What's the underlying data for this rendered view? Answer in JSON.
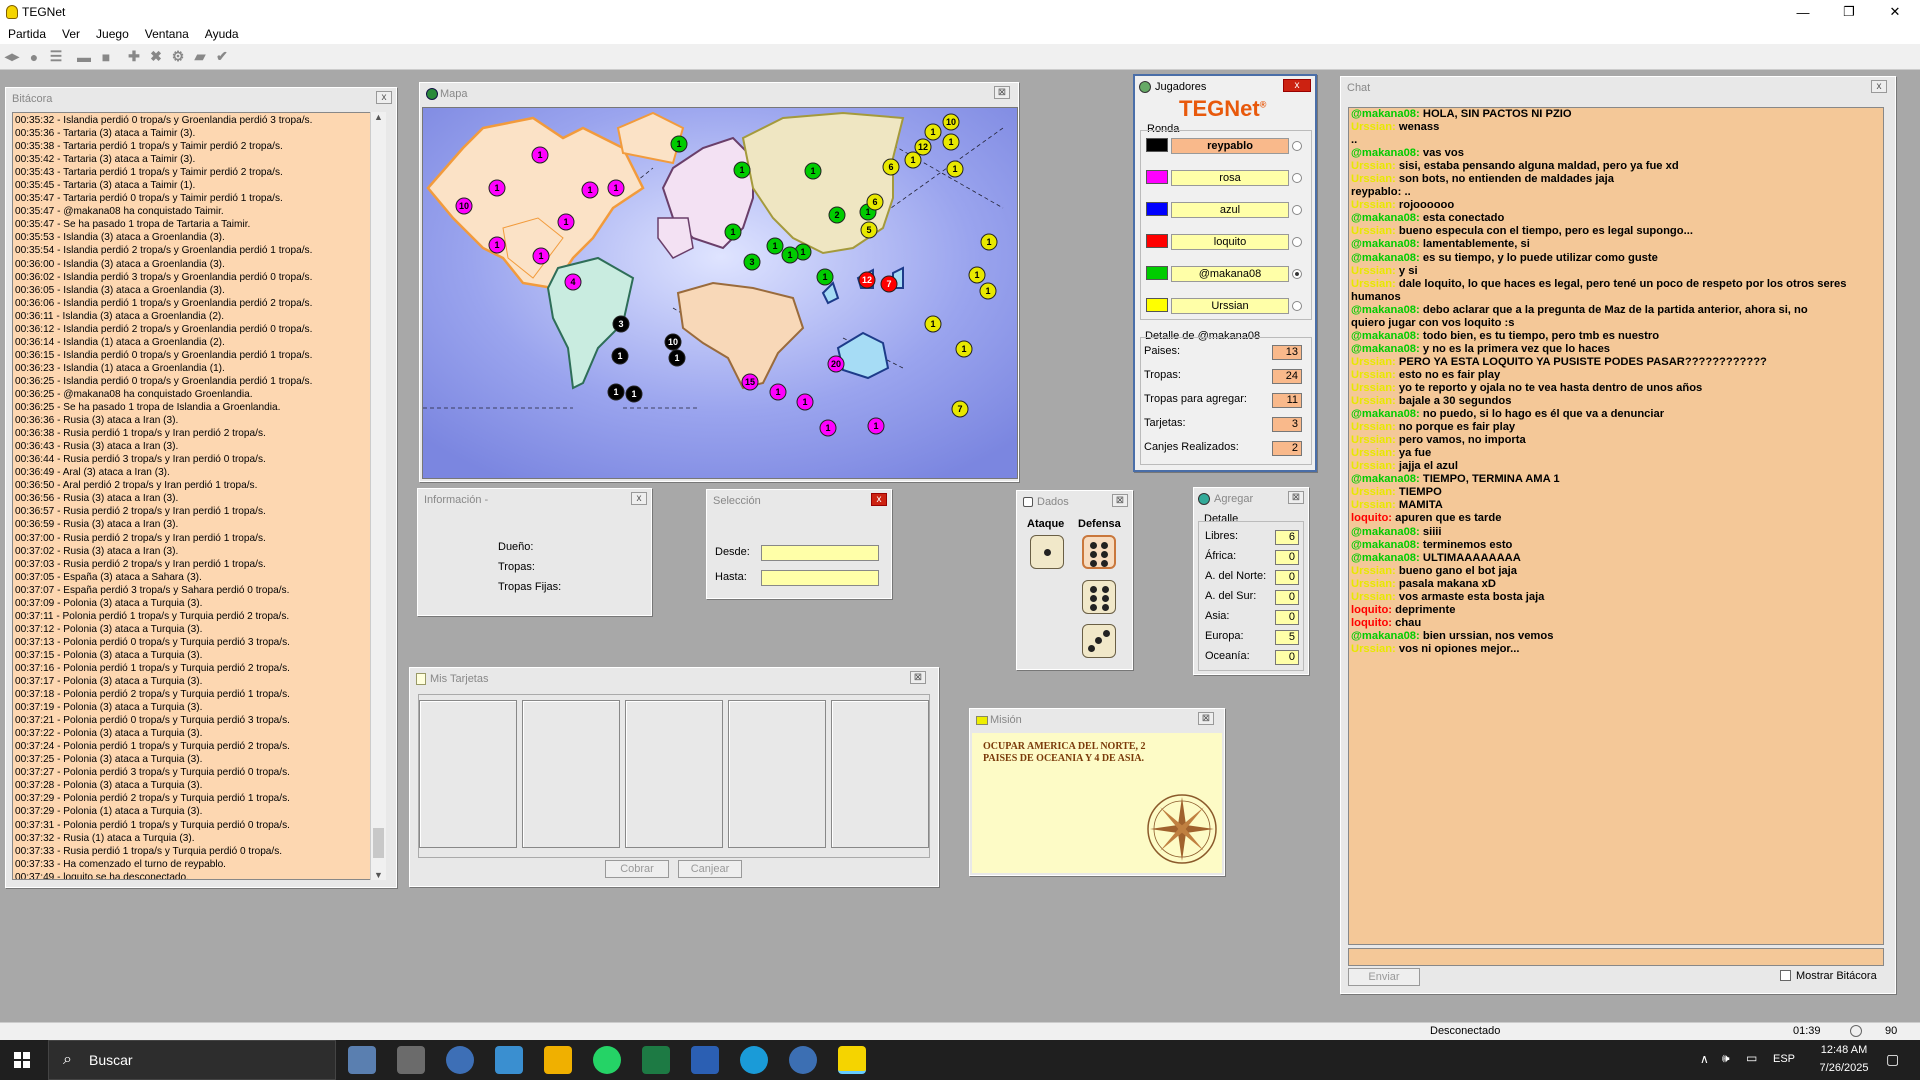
{
  "window": {
    "title": "TEGNet",
    "min": "—",
    "max": "❐",
    "close": "✕"
  },
  "menu": [
    "Partida",
    "Ver",
    "Juego",
    "Ventana",
    "Ayuda"
  ],
  "toolbar_icons": [
    "connect-icon",
    "start-icon",
    "list-icon",
    "stop-icon",
    "square-icon",
    "add-icon",
    "close-icon",
    "gear-icon",
    "card-icon",
    "check-icon"
  ],
  "bitacora": {
    "title": "Bitácora",
    "close": "x",
    "lines": [
      "00:35:32 - Islandia perdió 0 tropa/s y Groenlandia perdió 3 tropa/s.",
      "00:35:36 - Tartaria (3) ataca a Taimir (3).",
      "00:35:38 - Tartaria perdió 1 tropa/s y Taimir perdió 2 tropa/s.",
      "00:35:42 - Tartaria (3) ataca a Taimir (3).",
      "00:35:43 - Tartaria perdió 1 tropa/s y Taimir perdió 2 tropa/s.",
      "00:35:45 - Tartaria (3) ataca a Taimir (1).",
      "00:35:47 - Tartaria perdió 0 tropa/s y Taimir perdió 1 tropa/s.",
      "00:35:47 - @makana08 ha conquistado Taimir.",
      "00:35:47 - Se ha pasado 1 tropa de Tartaria a Taimir.",
      "00:35:53 - Islandia (3) ataca a Groenlandia (3).",
      "00:35:54 - Islandia perdió 2 tropa/s y Groenlandia perdió 1 tropa/s.",
      "00:36:00 - Islandia (3) ataca a Groenlandia (3).",
      "00:36:02 - Islandia perdió 3 tropa/s y Groenlandia perdió 0 tropa/s.",
      "00:36:05 - Islandia (3) ataca a Groenlandia (3).",
      "00:36:06 - Islandia perdió 1 tropa/s y Groenlandia perdió 2 tropa/s.",
      "00:36:11 - Islandia (3) ataca a Groenlandia (2).",
      "00:36:12 - Islandia perdió 2 tropa/s y Groenlandia perdió 0 tropa/s.",
      "00:36:14 - Islandia (1) ataca a Groenlandia (2).",
      "00:36:15 - Islandia perdió 0 tropa/s y Groenlandia perdió 1 tropa/s.",
      "00:36:23 - Islandia (1) ataca a Groenlandia (1).",
      "00:36:25 - Islandia perdió 0 tropa/s y Groenlandia perdió 1 tropa/s.",
      "00:36:25 - @makana08 ha conquistado Groenlandia.",
      "00:36:25 - Se ha pasado 1 tropa de Islandia a Groenlandia.",
      "00:36:36 - Rusia (3) ataca a Iran (3).",
      "00:36:38 - Rusia perdió 1 tropa/s y Iran perdió 2 tropa/s.",
      "00:36:43 - Rusia (3) ataca a Iran (3).",
      "00:36:44 - Rusia perdió 3 tropa/s y Iran perdió 0 tropa/s.",
      "00:36:49 - Aral (3) ataca a Iran (3).",
      "00:36:50 - Aral perdió 2 tropa/s y Iran perdió 1 tropa/s.",
      "00:36:56 - Rusia (3) ataca a Iran (3).",
      "00:36:57 - Rusia perdió 2 tropa/s y Iran perdió 1 tropa/s.",
      "00:36:59 - Rusia (3) ataca a Iran (3).",
      "00:37:00 - Rusia perdió 2 tropa/s y Iran perdió 1 tropa/s.",
      "00:37:02 - Rusia (3) ataca a Iran (3).",
      "00:37:03 - Rusia perdió 2 tropa/s y Iran perdió 1 tropa/s.",
      "00:37:05 - España (3) ataca a Sahara (3).",
      "00:37:07 - España perdió 3 tropa/s y Sahara perdió 0 tropa/s.",
      "00:37:09 - Polonia (3) ataca a Turquia (3).",
      "00:37:11 - Polonia perdió 1 tropa/s y Turquia perdió 2 tropa/s.",
      "00:37:12 - Polonia (3) ataca a Turquia (3).",
      "00:37:13 - Polonia perdió 0 tropa/s y Turquia perdió 3 tropa/s.",
      "00:37:15 - Polonia (3) ataca a Turquia (3).",
      "00:37:16 - Polonia perdió 1 tropa/s y Turquia perdió 2 tropa/s.",
      "00:37:17 - Polonia (3) ataca a Turquia (3).",
      "00:37:18 - Polonia perdió 2 tropa/s y Turquia perdió 1 tropa/s.",
      "00:37:19 - Polonia (3) ataca a Turquia (3).",
      "00:37:21 - Polonia perdió 0 tropa/s y Turquia perdió 3 tropa/s.",
      "00:37:22 - Polonia (3) ataca a Turquia (3).",
      "00:37:24 - Polonia perdió 1 tropa/s y Turquia perdió 2 tropa/s.",
      "00:37:25 - Polonia (3) ataca a Turquia (3).",
      "00:37:27 - Polonia perdió 3 tropa/s y Turquia perdió 0 tropa/s.",
      "00:37:28 - Polonia (3) ataca a Turquia (3).",
      "00:37:29 - Polonia perdió 2 tropa/s y Turquia perdió 1 tropa/s.",
      "00:37:29 - Polonia (1) ataca a Turquia (3).",
      "00:37:31 - Polonia perdió 1 tropa/s y Turquia perdió 0 tropa/s.",
      "00:37:32 - Rusia (1) ataca a Turquia (3).",
      "00:37:33 - Rusia perdió 1 tropa/s y Turquia perdió 0 tropa/s.",
      "00:37:33 - Ha comenzado el turno de reypablo.",
      "00:37:49 - loquito se ha desconectado."
    ]
  },
  "mapa": {
    "title": "Mapa",
    "close": "⊠"
  },
  "informacion": {
    "title": "Información -",
    "close": "x",
    "dueno": "Dueño:",
    "tropas": "Tropas:",
    "tropas_fijas": "Tropas Fijas:"
  },
  "seleccion": {
    "title": "Selección",
    "close": "x",
    "desde": "Desde:",
    "hasta": "Hasta:"
  },
  "tarjetas": {
    "title": "Mis Tarjetas",
    "close": "⊠",
    "cobrar": "Cobrar",
    "canjear": "Canjear"
  },
  "dados": {
    "title": "Dados",
    "close": "⊠",
    "ataque": "Ataque",
    "defensa": "Defensa",
    "ataque_dice": [
      1
    ],
    "defensa_dice": [
      6,
      6,
      3
    ]
  },
  "jugadores": {
    "title": "Jugadores",
    "close": "x",
    "logo": "TEGNet",
    "logo_mark": "®",
    "ronda": "Ronda",
    "players": [
      {
        "color": "#000000",
        "name": "reypablo",
        "active": true
      },
      {
        "color": "#ff00ff",
        "name": "rosa",
        "active": false
      },
      {
        "color": "#0000ff",
        "name": "azul",
        "active": false
      },
      {
        "color": "#ff0000",
        "name": "loquito",
        "active": false
      },
      {
        "color": "#00cc00",
        "name": "@makana08",
        "active": false,
        "selected": true
      },
      {
        "color": "#ffff00",
        "name": "Urssian",
        "active": false
      }
    ],
    "detalle_title": "Detalle de @makana08",
    "stats": [
      {
        "label": "Paises:",
        "value": "13"
      },
      {
        "label": "Tropas:",
        "value": "24"
      },
      {
        "label": "Tropas para agregar:",
        "value": "11"
      },
      {
        "label": "Tarjetas:",
        "value": "3"
      },
      {
        "label": "Canjes Realizados:",
        "value": "2"
      }
    ]
  },
  "agregar": {
    "title": "Agregar",
    "close": "⊠",
    "detalle": "Detalle",
    "rows": [
      {
        "label": "Libres:",
        "value": "6"
      },
      {
        "label": "África:",
        "value": "0"
      },
      {
        "label": "A. del Norte:",
        "value": "0"
      },
      {
        "label": "A. del Sur:",
        "value": "0"
      },
      {
        "label": "Asia:",
        "value": "0"
      },
      {
        "label": "Europa:",
        "value": "5"
      },
      {
        "label": "Oceanía:",
        "value": "0"
      }
    ]
  },
  "mision": {
    "title": "Misión",
    "close": "⊠",
    "text1": "OCUPAR AMERICA DEL NORTE, 2",
    "text2": "PAISES DE OCEANIA Y 4 DE ASIA."
  },
  "chat": {
    "title": "Chat",
    "close": "x",
    "enviar": "Enviar",
    "mostrar": "Mostrar Bitácora",
    "lines": [
      {
        "u": "@makana08:",
        "c": "#00cc00",
        "m": "HOLA, SIN PACTOS NI PZIO"
      },
      {
        "u": "Urssian:",
        "c": "#e8e800",
        "m": "wenass"
      },
      {
        "u": "",
        "c": "#000",
        "m": ".."
      },
      {
        "u": "@makana08:",
        "c": "#00cc00",
        "m": "vas vos"
      },
      {
        "u": "Urssian:",
        "c": "#e8e800",
        "m": "sisi, estaba pensando alguna maldad, pero ya fue xd"
      },
      {
        "u": "Urssian:",
        "c": "#e8e800",
        "m": "son bots, no entienden de maldades jaja"
      },
      {
        "u": "reypablo:",
        "c": "#000",
        "m": ".."
      },
      {
        "u": "Urssian:",
        "c": "#e8e800",
        "m": "rojoooooo"
      },
      {
        "u": "@makana08:",
        "c": "#00cc00",
        "m": "esta conectado"
      },
      {
        "u": "Urssian:",
        "c": "#e8e800",
        "m": "bueno especula con el tiempo, pero es legal supongo..."
      },
      {
        "u": "@makana08:",
        "c": "#00cc00",
        "m": "lamentablemente, si"
      },
      {
        "u": "@makana08:",
        "c": "#00cc00",
        "m": "es su tiempo, y lo puede utilizar como guste"
      },
      {
        "u": "Urssian:",
        "c": "#e8e800",
        "m": "y si"
      },
      {
        "u": "Urssian:",
        "c": "#e8e800",
        "m": "dale loquito, lo que haces es legal, pero tené un poco de respeto por los otros seres"
      },
      {
        "u": "",
        "c": "#000",
        "m": "humanos"
      },
      {
        "u": "@makana08:",
        "c": "#00cc00",
        "m": "debo aclarar que a la pregunta de Maz de la partida anterior, ahora si, no"
      },
      {
        "u": "",
        "c": "#000",
        "m": "quiero jugar con vos loquito :s"
      },
      {
        "u": "@makana08:",
        "c": "#00cc00",
        "m": "todo bien, es tu tiempo, pero tmb es nuestro"
      },
      {
        "u": "@makana08:",
        "c": "#00cc00",
        "m": "y no es la primera vez que lo haces"
      },
      {
        "u": "Urssian:",
        "c": "#e8e800",
        "m": "PERO YA ESTA LOQUITO YA PUSISTE PODES PASAR????????????"
      },
      {
        "u": "Urssian:",
        "c": "#e8e800",
        "m": "esto no es fair play"
      },
      {
        "u": "Urssian:",
        "c": "#e8e800",
        "m": "yo te reporto y ojala no te vea hasta dentro de unos años"
      },
      {
        "u": "Urssian:",
        "c": "#e8e800",
        "m": "bajale a 30 segundos"
      },
      {
        "u": "@makana08:",
        "c": "#00cc00",
        "m": "no puedo, si lo hago es él que va a denunciar"
      },
      {
        "u": "Urssian:",
        "c": "#e8e800",
        "m": "no porque es fair play"
      },
      {
        "u": "Urssian:",
        "c": "#e8e800",
        "m": "pero vamos, no importa"
      },
      {
        "u": "Urssian:",
        "c": "#e8e800",
        "m": "ya fue"
      },
      {
        "u": "Urssian:",
        "c": "#e8e800",
        "m": "jajja el azul"
      },
      {
        "u": "@makana08:",
        "c": "#00cc00",
        "m": "TIEMPO, TERMINA AMA 1"
      },
      {
        "u": "Urssian:",
        "c": "#e8e800",
        "m": "TIEMPO"
      },
      {
        "u": "Urssian:",
        "c": "#e8e800",
        "m": "MAMITA"
      },
      {
        "u": "loquito:",
        "c": "#ff0000",
        "m": "apuren que es tarde"
      },
      {
        "u": "@makana08:",
        "c": "#00cc00",
        "m": "siiii"
      },
      {
        "u": "@makana08:",
        "c": "#00cc00",
        "m": "terminemos esto"
      },
      {
        "u": "@makana08:",
        "c": "#00cc00",
        "m": "ULTIMAAAAAAAA"
      },
      {
        "u": "Urssian:",
        "c": "#e8e800",
        "m": "bueno gano el bot jaja"
      },
      {
        "u": "Urssian:",
        "c": "#e8e800",
        "m": "pasala makana xD"
      },
      {
        "u": "Urssian:",
        "c": "#e8e800",
        "m": "vos armaste esta bosta jaja"
      },
      {
        "u": "loquito:",
        "c": "#ff0000",
        "m": "deprimente"
      },
      {
        "u": "loquito:",
        "c": "#ff0000",
        "m": "chau"
      },
      {
        "u": "@makana08:",
        "c": "#00cc00",
        "m": "bien urssian, nos vemos"
      },
      {
        "u": "Urssian:",
        "c": "#e8e800",
        "m": "vos ni opiones mejor..."
      }
    ]
  },
  "status": {
    "state": "Desconectado",
    "time": "01:39",
    "num": "90"
  },
  "taskbar": {
    "search": "Buscar",
    "lang": "ESP",
    "time": "12:48 AM",
    "date": "7/26/2025"
  },
  "map_armies": [
    {
      "n": "1",
      "c": "#ff00ff"
    },
    {
      "n": "1",
      "c": "#ff00ff"
    },
    {
      "n": "10",
      "c": "#ff00ff"
    },
    {
      "n": "1",
      "c": "#ff00ff"
    },
    {
      "n": "1",
      "c": "#ff00ff"
    },
    {
      "n": "1",
      "c": "#ff00ff"
    },
    {
      "n": "1",
      "c": "#ff00ff"
    },
    {
      "n": "1",
      "c": "#ff00ff"
    },
    {
      "n": "4",
      "c": "#ff00ff"
    },
    {
      "n": "1",
      "c": "#00cc00"
    },
    {
      "n": "1",
      "c": "#00cc00"
    },
    {
      "n": "1",
      "c": "#00cc00"
    },
    {
      "n": "1",
      "c": "#00cc00"
    },
    {
      "n": "1",
      "c": "#00cc00"
    },
    {
      "n": "2",
      "c": "#00cc00"
    },
    {
      "n": "1",
      "c": "#00cc00"
    },
    {
      "n": "1",
      "c": "#00cc00"
    },
    {
      "n": "1",
      "c": "#00cc00"
    },
    {
      "n": "3",
      "c": "#00cc00"
    },
    {
      "n": "1",
      "c": "#00cc00"
    },
    {
      "n": "3",
      "c": "#000000"
    },
    {
      "n": "10",
      "c": "#000000"
    },
    {
      "n": "1",
      "c": "#000000"
    },
    {
      "n": "1",
      "c": "#000000"
    },
    {
      "n": "1",
      "c": "#000000"
    },
    {
      "n": "1",
      "c": "#000000"
    },
    {
      "n": "10",
      "c": "#e8e800"
    },
    {
      "n": "1",
      "c": "#e8e800"
    },
    {
      "n": "12",
      "c": "#e8e800"
    },
    {
      "n": "1",
      "c": "#e8e800"
    },
    {
      "n": "6",
      "c": "#e8e800"
    },
    {
      "n": "1",
      "c": "#e8e800"
    },
    {
      "n": "1",
      "c": "#e8e800"
    },
    {
      "n": "6",
      "c": "#e8e800"
    },
    {
      "n": "5",
      "c": "#e8e800"
    },
    {
      "n": "1",
      "c": "#e8e800"
    },
    {
      "n": "1",
      "c": "#e8e800"
    },
    {
      "n": "1",
      "c": "#e8e800"
    },
    {
      "n": "1",
      "c": "#e8e800"
    },
    {
      "n": "1",
      "c": "#e8e800"
    },
    {
      "n": "7",
      "c": "#e8e800"
    },
    {
      "n": "12",
      "c": "#ff0000"
    },
    {
      "n": "7",
      "c": "#ff0000"
    },
    {
      "n": "15",
      "c": "#ff00ff"
    },
    {
      "n": "20",
      "c": "#ff00ff"
    },
    {
      "n": "1",
      "c": "#ff00ff"
    },
    {
      "n": "1",
      "c": "#ff00ff"
    },
    {
      "n": "1",
      "c": "#ff00ff"
    },
    {
      "n": "1",
      "c": "#ff00ff"
    }
  ]
}
